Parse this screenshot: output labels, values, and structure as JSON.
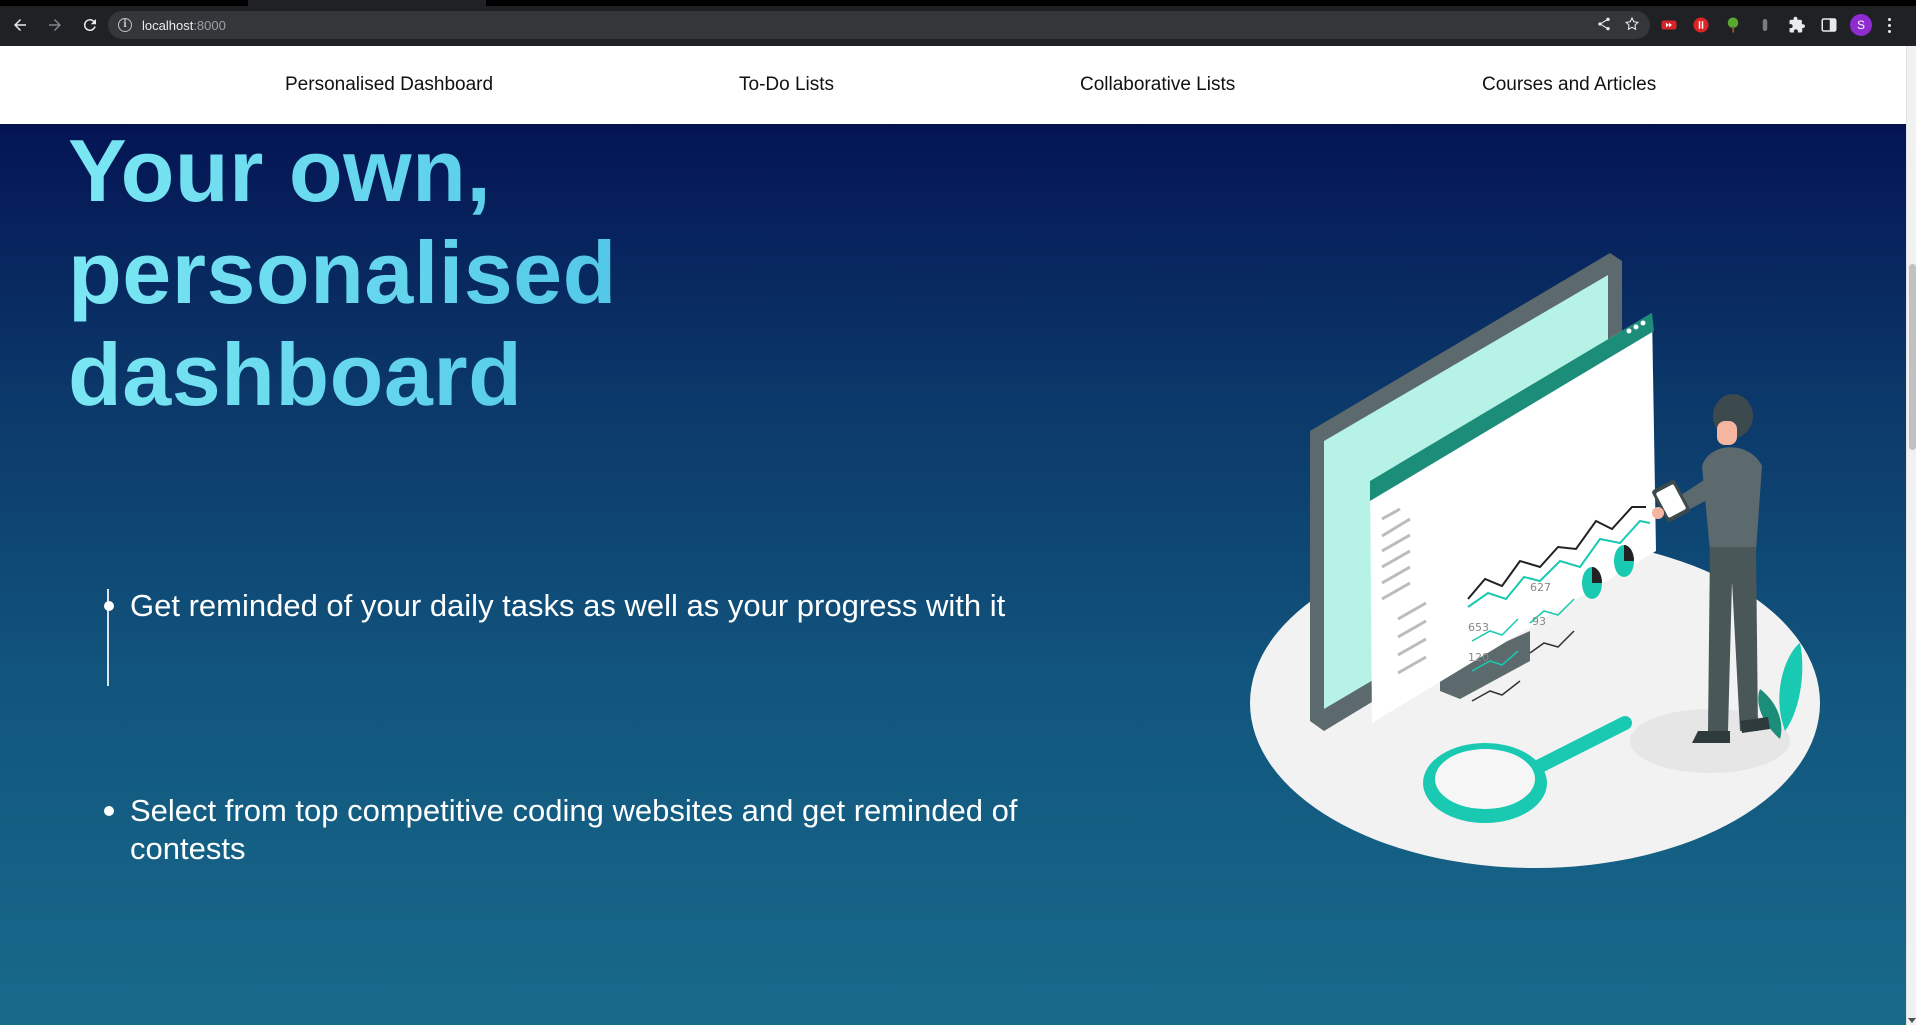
{
  "browser": {
    "url_host": "localhost",
    "url_port": ":8000",
    "profile_initial": "S"
  },
  "nav": {
    "items": [
      {
        "label": "Personalised Dashboard"
      },
      {
        "label": "To-Do Lists"
      },
      {
        "label": "Collaborative Lists"
      },
      {
        "label": "Courses and Articles"
      }
    ]
  },
  "hero": {
    "title": "Your own, personalised dashboard",
    "features": [
      "Get reminded of your daily tasks as well as your progress with it",
      "Select from top competitive coding websites and get reminded of contests"
    ],
    "illustration_stats": [
      "627",
      "653",
      "93",
      "120"
    ]
  },
  "colors": {
    "nav_background": "#ffffff",
    "page_gradient_top": "#020a4e",
    "page_gradient_bottom": "#186a8b",
    "title_gradient_start": "#7be7f3",
    "title_gradient_end": "#3aa8dc",
    "accent_teal": "#19c9b1",
    "profile_avatar": "#8e2bd1"
  }
}
